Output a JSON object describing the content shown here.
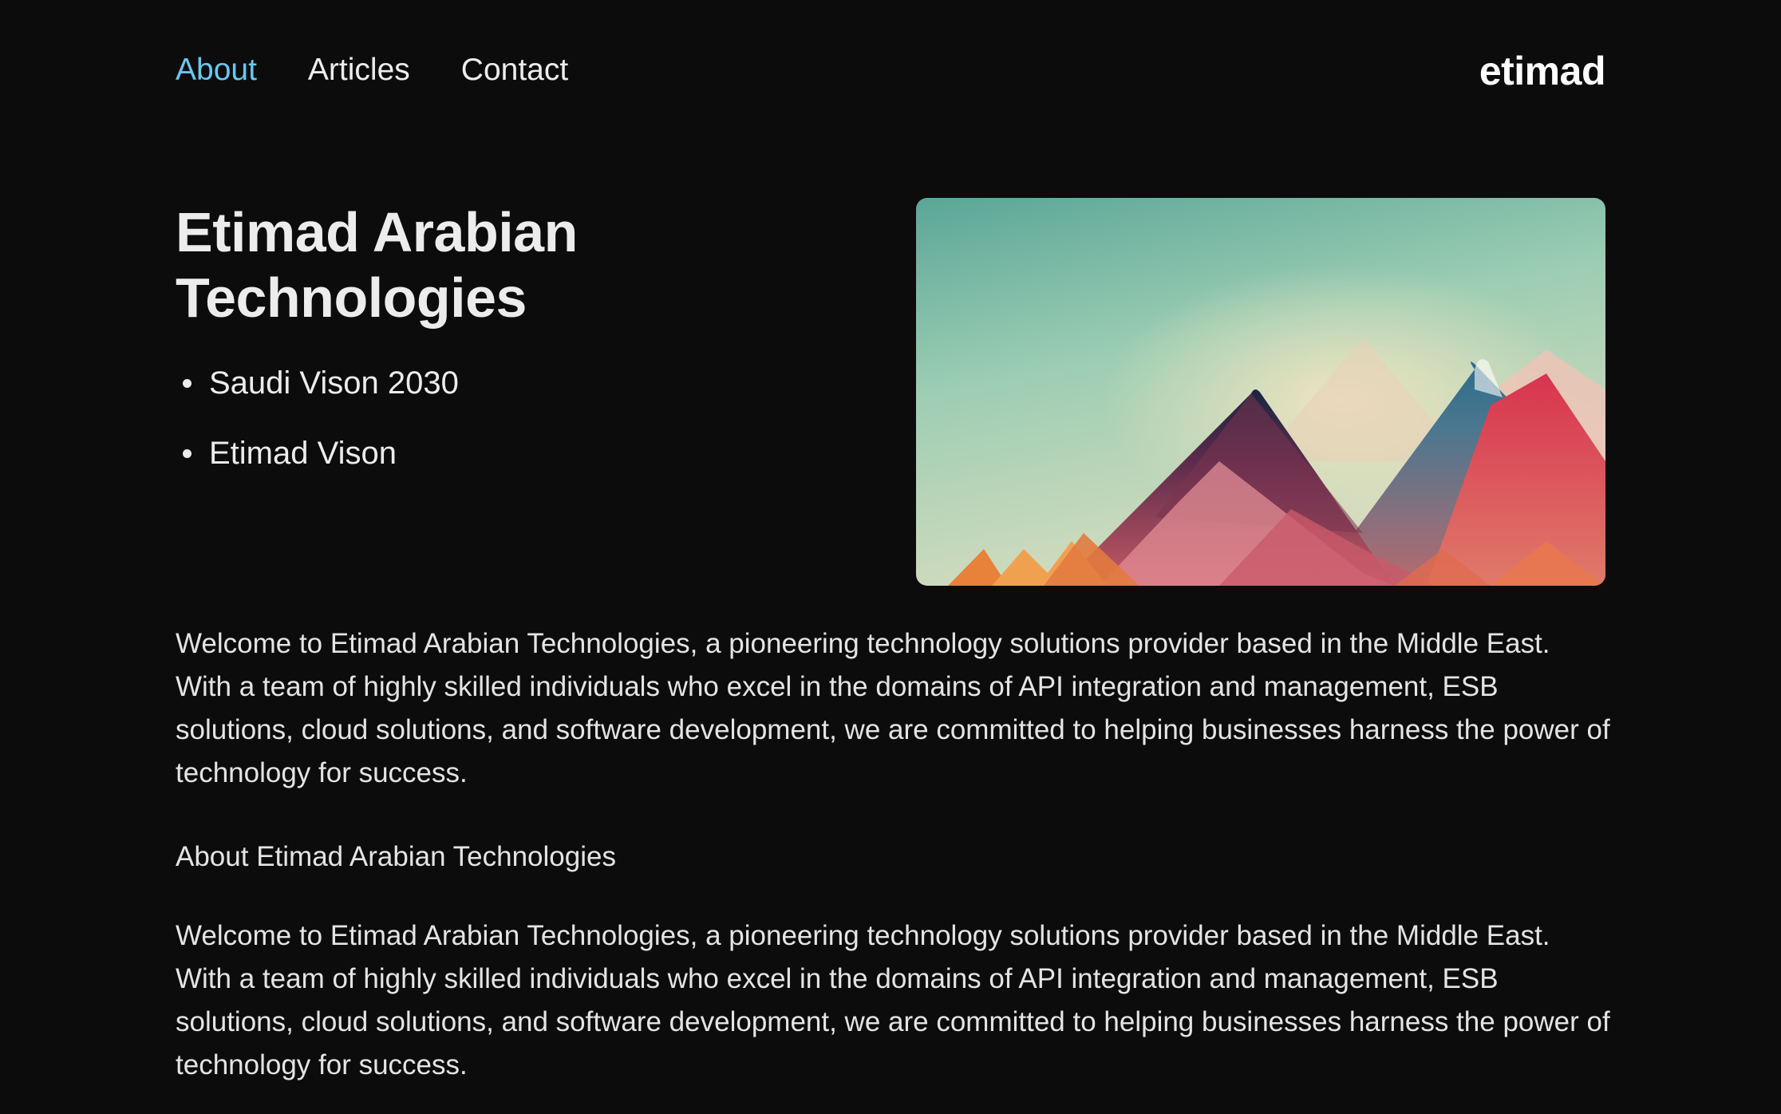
{
  "nav": {
    "items": [
      {
        "label": "About",
        "active": true
      },
      {
        "label": "Articles",
        "active": false
      },
      {
        "label": "Contact",
        "active": false
      }
    ]
  },
  "brand": {
    "logo_text": "etimad"
  },
  "hero": {
    "title": "Etimad Arabian Technologies",
    "bullets": [
      "Saudi Vison 2030",
      "Etimad Vison"
    ],
    "image_alt": "mountain-landscape-illustration"
  },
  "content": {
    "intro": "Welcome to Etimad Arabian Technologies, a pioneering technology solutions provider based in the Middle East. With a team of highly skilled individuals who excel in the domains of API integration and management, ESB solutions, cloud solutions, and software development, we are committed to helping businesses harness the power of technology for success.",
    "section_heading": "About Etimad Arabian Technologies",
    "body": "Welcome to Etimad Arabian Technologies, a pioneering technology solutions provider based in the Middle East. With a team of highly skilled individuals who excel in the domains of API integration and management, ESB solutions, cloud solutions, and software development, we are committed to helping businesses harness the power of technology for success."
  },
  "colors": {
    "background": "#0c0c0d",
    "accent": "#6cc6ee",
    "text": "#e7e7e7"
  }
}
